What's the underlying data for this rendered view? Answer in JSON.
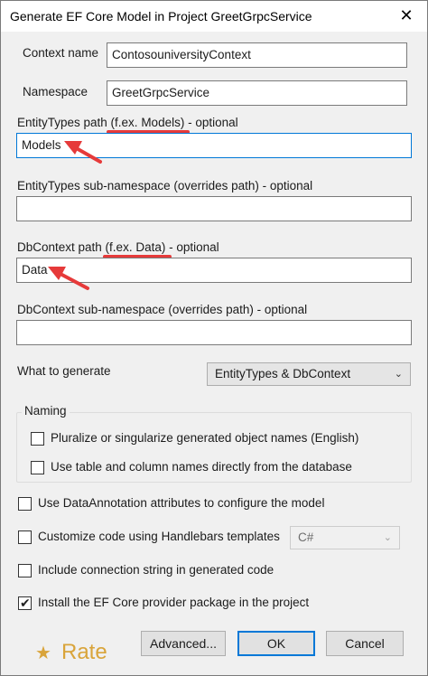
{
  "window": {
    "title": "Generate EF Core Model in Project GreetGrpcService",
    "close_glyph": "✕"
  },
  "fields": {
    "context_name": {
      "label": "Context name",
      "value": "ContosouniversityContext"
    },
    "namespace": {
      "label": "Namespace",
      "value": "GreetGrpcService"
    },
    "entity_path": {
      "label": "EntityTypes path (f.ex. Models) - optional",
      "value": "Models"
    },
    "entity_subns": {
      "label": "EntityTypes sub-namespace (overrides path) - optional",
      "value": ""
    },
    "dbcontext_path": {
      "label": "DbContext path (f.ex. Data) - optional",
      "value": "Data"
    },
    "dbcontext_subns": {
      "label": "DbContext sub-namespace (overrides path) - optional",
      "value": ""
    }
  },
  "generate": {
    "label": "What to generate",
    "selected": "EntityTypes & DbContext",
    "arrow_glyph": "⌄"
  },
  "naming": {
    "title": "Naming",
    "options": [
      {
        "label": "Pluralize or singularize generated object names (English)",
        "checked": false
      },
      {
        "label": "Use table and column names directly from the database",
        "checked": false
      }
    ]
  },
  "options": [
    {
      "label": "Use DataAnnotation attributes to configure the model",
      "checked": false
    },
    {
      "label": "Customize code using Handlebars templates",
      "checked": false
    },
    {
      "label": "Include connection string in generated code",
      "checked": false
    },
    {
      "label": "Install the EF Core provider package in the project",
      "checked": true
    }
  ],
  "language": {
    "selected": "C#",
    "arrow_glyph": "⌄"
  },
  "check_glyph": "✔",
  "footer": {
    "rate_star": "★",
    "rate_label": "Rate",
    "advanced_label": "Advanced...",
    "ok_label": "OK",
    "cancel_label": "Cancel"
  },
  "colors": {
    "annotation_red": "#e63a3a",
    "rate_gold": "#d9a43a",
    "focus_blue": "#0078d7"
  }
}
